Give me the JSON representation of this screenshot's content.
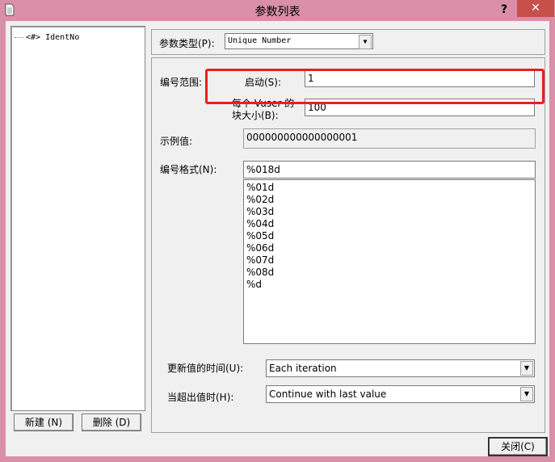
{
  "window": {
    "title": "参数列表",
    "help_label": "?",
    "close_label": "✕"
  },
  "tree": {
    "items": [
      {
        "label": "<#> IdentNo"
      }
    ]
  },
  "buttons": {
    "new_label": "新建 (N)",
    "delete_label": "删除 (D)",
    "close_label": "关闭(C)"
  },
  "param_type": {
    "label": "参数类型(P):",
    "value": "Unique Number"
  },
  "number_range": {
    "label": "编号范围:",
    "start_label": "启动(S):",
    "start_value": "1",
    "block_label_line1": "每个 Vuser 的",
    "block_label_line2": "块大小(B):",
    "block_value": "100"
  },
  "sample": {
    "label": "示例值:",
    "value": "000000000000000001"
  },
  "format": {
    "label": "编号格式(N):",
    "value": "%018d",
    "options": [
      "%01d",
      "%02d",
      "%03d",
      "%04d",
      "%05d",
      "%06d",
      "%07d",
      "%08d",
      "%d"
    ]
  },
  "update": {
    "label": "更新值的时间(U):",
    "value": "Each iteration"
  },
  "out_of_values": {
    "label": "当超出值时(H):",
    "value": "Continue with last value"
  },
  "colors": {
    "titlebar": "#d98fa8",
    "close_button": "#c7504a",
    "highlight": "#e8201e"
  }
}
